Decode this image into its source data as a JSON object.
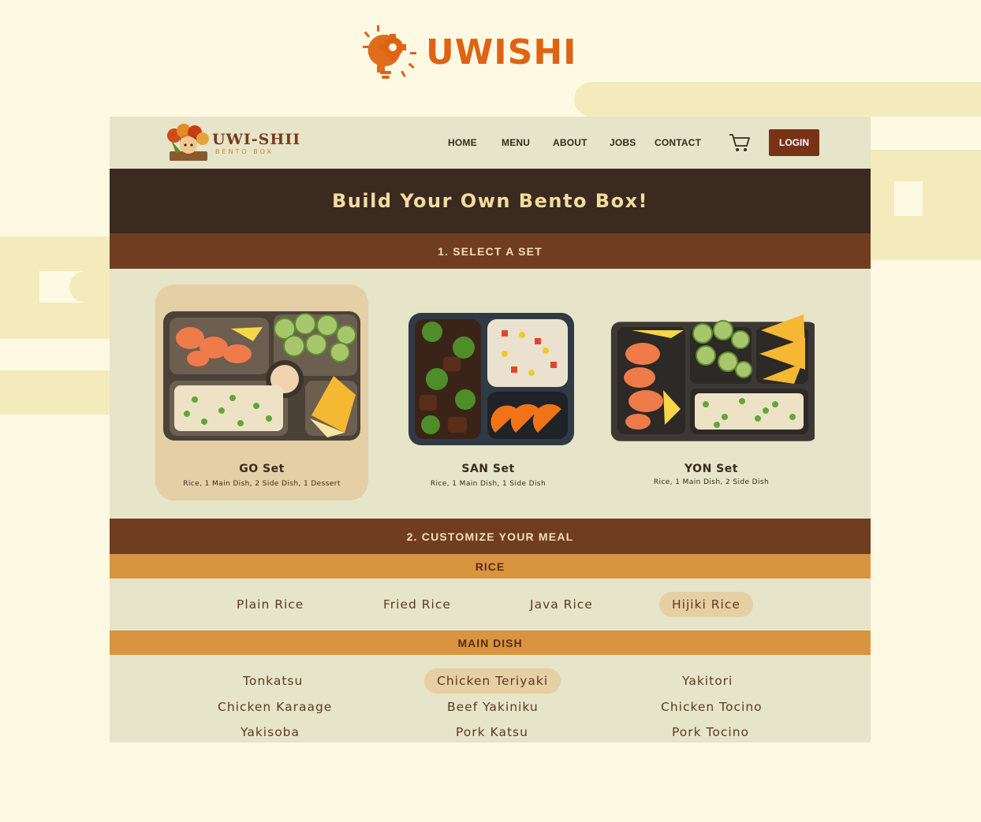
{
  "brand": {
    "name": "UWISHI",
    "logo_icon": "lightbulb-gear-icon"
  },
  "site": {
    "logo_name": "UWI-SHII",
    "logo_sub": "BENTO BOX"
  },
  "nav": {
    "items": [
      "HOME",
      "MENU",
      "ABOUT",
      "JOBS",
      "CONTACT"
    ],
    "cart_icon": "cart-icon",
    "login_label": "LOGIN"
  },
  "hero": {
    "title": "Build Your Own Bento Box!"
  },
  "step1": {
    "label": "1. SELECT A SET",
    "sets": [
      {
        "name": "GO Set",
        "desc": "Rice, 1 Main Dish, 2 Side Dish, 1 Dessert",
        "selected": true
      },
      {
        "name": "SAN Set",
        "desc": "Rice, 1 Main Dish, 1 Side Dish",
        "selected": false
      },
      {
        "name": "YON Set",
        "desc": "Rice, 1 Main Dish, 2 Side Dish",
        "selected": false
      }
    ]
  },
  "step2": {
    "label": "2. CUSTOMIZE YOUR MEAL",
    "rice": {
      "label": "RICE",
      "options": [
        "Plain Rice",
        "Fried Rice",
        "Java Rice",
        "Hijiki Rice"
      ],
      "selected": "Hijiki Rice"
    },
    "main_dish": {
      "label": "MAIN DISH",
      "options": [
        "Tonkatsu",
        "Chicken Teriyaki",
        "Yakitori",
        "Chicken Karaage",
        "Beef Yakiniku",
        "Chicken Tocino",
        "Yakisoba",
        "Pork Katsu",
        "Pork Tocino"
      ],
      "selected": "Chicken Teriyaki"
    }
  },
  "colors": {
    "page_bg": "#fef9e3",
    "frame_bg": "#e6e4c9",
    "hero_bg": "#3b2a20",
    "section_bar": "#713d21",
    "sub_bar": "#d99440",
    "brand_orange": "#de6413",
    "selected_chip": "#e6cfa3"
  }
}
